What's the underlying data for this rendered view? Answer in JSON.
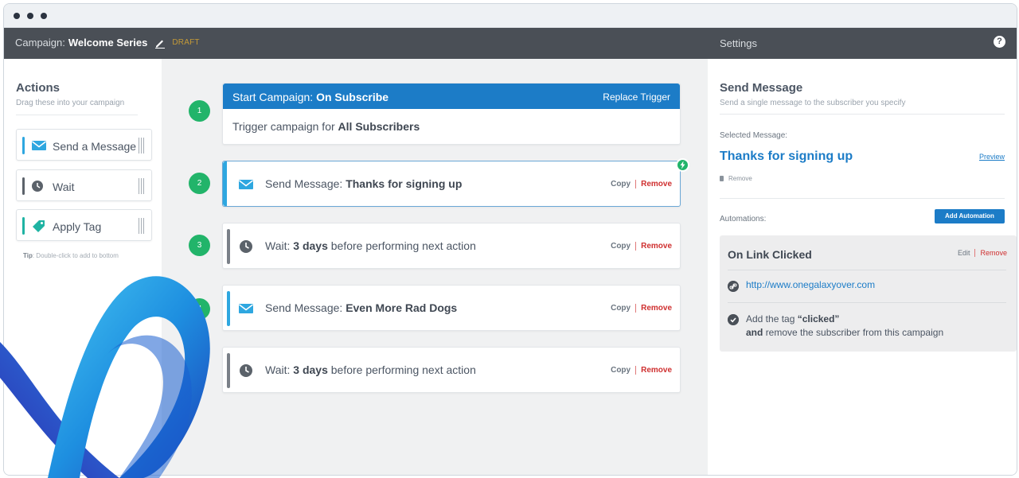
{
  "topbar": {
    "campaign_prefix": "Campaign:",
    "campaign_name": "Welcome Series",
    "status": "DRAFT",
    "settings_label": "Settings",
    "help_label": "?"
  },
  "actions_panel": {
    "title": "Actions",
    "subtitle": "Drag these into your campaign",
    "items": [
      {
        "label": "Send a Message",
        "icon": "envelope-icon",
        "color": "#2ea7e0"
      },
      {
        "label": "Wait",
        "icon": "clock-icon",
        "color": "#5b626a"
      },
      {
        "label": "Apply Tag",
        "icon": "tag-icon",
        "color": "#1fb3a3"
      }
    ],
    "tip_bold": "Tip",
    "tip_text": ": Double-click to add to bottom"
  },
  "workflow": {
    "trigger": {
      "step": "1",
      "header_prefix": "Start Campaign:",
      "header_value": "On Subscribe",
      "replace_label": "Replace Trigger",
      "body_prefix": "Trigger campaign for",
      "body_value": "All Subscribers"
    },
    "steps": [
      {
        "step": "2",
        "prefix": "Send Message:",
        "value": "Thanks for signing up",
        "suffix": "",
        "copy": "Copy",
        "remove": "Remove"
      },
      {
        "step": "3",
        "prefix": "Wait:",
        "value": "3 days",
        "suffix": "before performing next action",
        "copy": "Copy",
        "remove": "Remove"
      },
      {
        "step": "4",
        "prefix": "Send Message:",
        "value": "Even More Rad Dogs",
        "suffix": "",
        "copy": "Copy",
        "remove": "Remove"
      },
      {
        "step": "",
        "prefix": "Wait:",
        "value": "3 days",
        "suffix": "before performing next action",
        "copy": "Copy",
        "remove": "Remove"
      }
    ]
  },
  "settings_panel": {
    "title": "Send Message",
    "subtitle": "Send a single message to the subscriber you specify",
    "selected_label": "Selected Message:",
    "selected_message": "Thanks for signing up",
    "preview_label": "Preview",
    "remove_label": "Remove",
    "automations_label": "Automations:",
    "add_automation_label": "Add Automation",
    "automation": {
      "title": "On Link Clicked",
      "edit_label": "Edit",
      "remove_label": "Remove",
      "url": "http://www.onegalaxyover.com",
      "action_prefix": "Add the tag",
      "tag": "“clicked”",
      "action_and": "and",
      "action_suffix": "remove the subscriber from this campaign"
    }
  },
  "colors": {
    "accent_blue": "#1c7cc7",
    "step_green": "#22b46a",
    "remove_red": "#cf2f2f",
    "topbar": "#4a4f56"
  }
}
